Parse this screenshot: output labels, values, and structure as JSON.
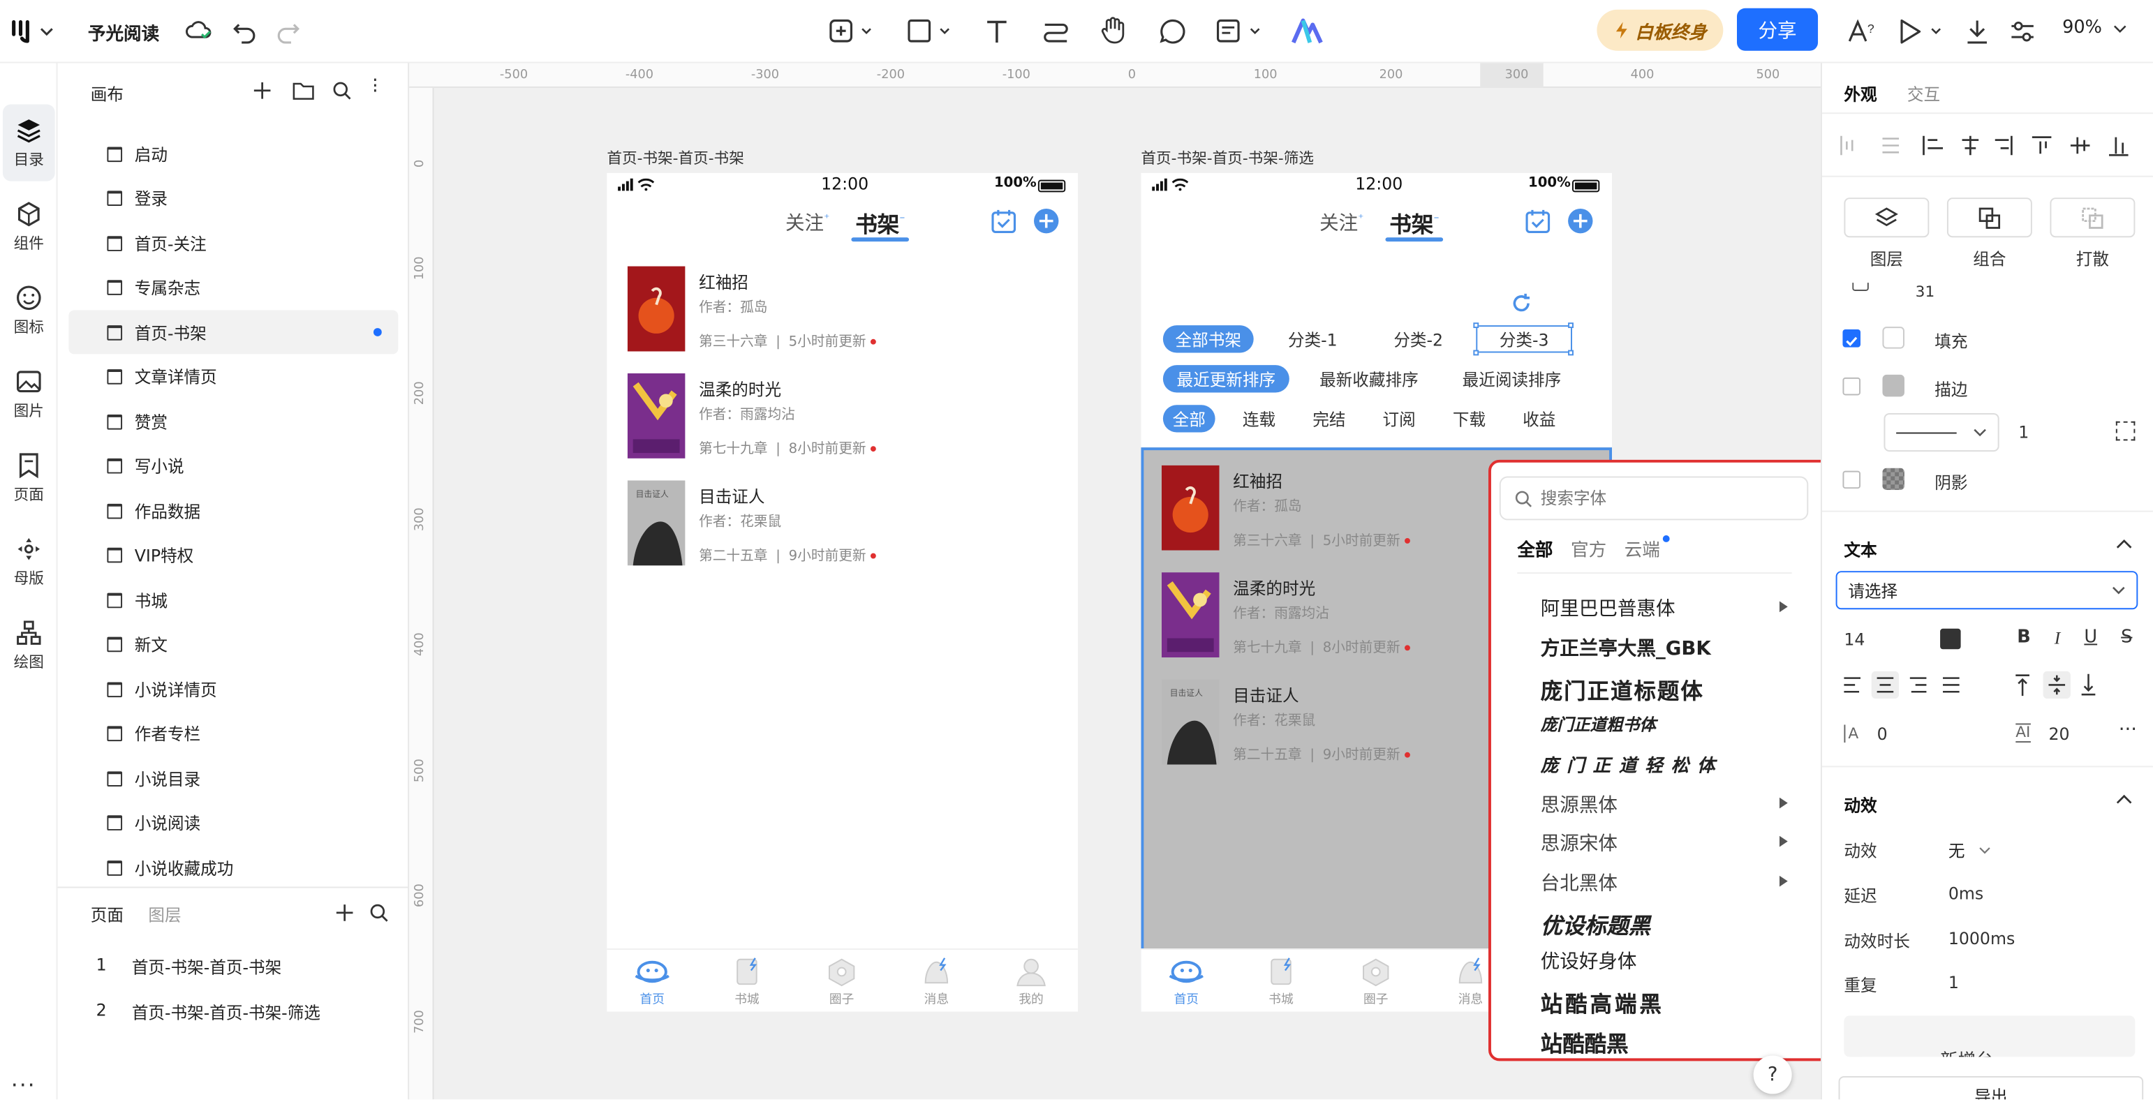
{
  "app": {
    "title": "予光阅读",
    "zoom": "90%",
    "upgrade_label": "白板终身",
    "share_label": "分享"
  },
  "rail": [
    {
      "label": "目录",
      "icon": "layers-icon"
    },
    {
      "label": "组件",
      "icon": "component-icon"
    },
    {
      "label": "图标",
      "icon": "smile-icon"
    },
    {
      "label": "图片",
      "icon": "image-icon"
    },
    {
      "label": "页面",
      "icon": "page-icon"
    },
    {
      "label": "母版",
      "icon": "master-icon"
    },
    {
      "label": "绘图",
      "icon": "draw-icon"
    }
  ],
  "panel": {
    "header": "画布",
    "pages": [
      "启动",
      "登录",
      "首页-关注",
      "专属杂志",
      "首页-书架",
      "文章详情页",
      "赞赏",
      "写小说",
      "作品数据",
      "VIP特权",
      "书城",
      "新文",
      "小说详情页",
      "作者专栏",
      "小说目录",
      "小说阅读",
      "小说收藏成功"
    ],
    "tabs": [
      "页面",
      "图层"
    ],
    "subpages": [
      {
        "num": "1",
        "label": "首页-书架-首页-书架"
      },
      {
        "num": "2",
        "label": "首页-书架-首页-书架-筛选"
      }
    ]
  },
  "ruler": {
    "top": [
      "-500",
      "-400",
      "-300",
      "-200",
      "-100",
      "0",
      "100",
      "200",
      "300",
      "400",
      "500"
    ],
    "left": [
      "0",
      "100",
      "200",
      "300",
      "400",
      "500",
      "600",
      "700"
    ]
  },
  "frame1": {
    "label": "首页-书架-首页-书架"
  },
  "frame2": {
    "label": "首页-书架-首页-书架-筛选"
  },
  "phone": {
    "time": "12:00",
    "battery": "100%",
    "tab_follow": "关注",
    "tab_shelf": "书架",
    "books": [
      {
        "title": "红袖招",
        "author": "作者：孤岛",
        "chapter": "第三十六章",
        "update": "5小时前更新"
      },
      {
        "title": "温柔的时光",
        "author": "作者：雨露均沾",
        "chapter": "第七十九章",
        "update": "8小时前更新"
      },
      {
        "title": "目击证人",
        "author": "作者：花栗鼠",
        "chapter": "第二十五章",
        "update": "9小时前更新"
      }
    ],
    "bottom_tabs": [
      "首页",
      "书城",
      "圈子",
      "消息",
      "我的"
    ],
    "filter_row1": [
      "全部书架",
      "分类-1",
      "分类-2",
      "分类-3"
    ],
    "filter_row2": [
      "最近更新排序",
      "最新收藏排序",
      "最近阅读排序"
    ],
    "filter_row3": [
      "全部",
      "连载",
      "完结",
      "订阅",
      "下载",
      "收益"
    ],
    "separator": "|"
  },
  "fontpicker": {
    "placeholder": "搜索字体",
    "tabs": [
      "全部",
      "官方",
      "云端"
    ],
    "fonts": [
      "阿里巴巴普惠体",
      "方正兰亭大黑_GBK",
      "庞门正道标题体",
      "庞门正道粗书体",
      "庞门正道轻松体",
      "思源黑体",
      "思源宋体",
      "台北黑体",
      "优设标题黑",
      "优设好身体",
      "站酷高端黑",
      "站酷酷黑"
    ]
  },
  "right": {
    "tabs": [
      "外观",
      "交互"
    ],
    "actions": [
      "图层",
      "组合",
      "打散"
    ],
    "radius_value": "31",
    "fill": "填充",
    "stroke": "描边",
    "stroke_width": "1",
    "shadow": "阴影",
    "text_section": "文本",
    "font_select": "请选择",
    "font_size": "14",
    "letter_spacing": "0",
    "line_height": "20",
    "anim_section": "动效",
    "anim_label": "动效",
    "anim_value": "无",
    "delay_label": "延迟",
    "delay_value": "0ms",
    "duration_label": "动效时长",
    "duration_value": "1000ms",
    "repeat_label": "重复",
    "repeat_value": "1",
    "partial_label": "新增台一",
    "export_label": "导出",
    "help": "?"
  },
  "colors": {
    "accent": "#1e6fff",
    "red": "#e03030",
    "chip_blue": "#4a90e8"
  }
}
